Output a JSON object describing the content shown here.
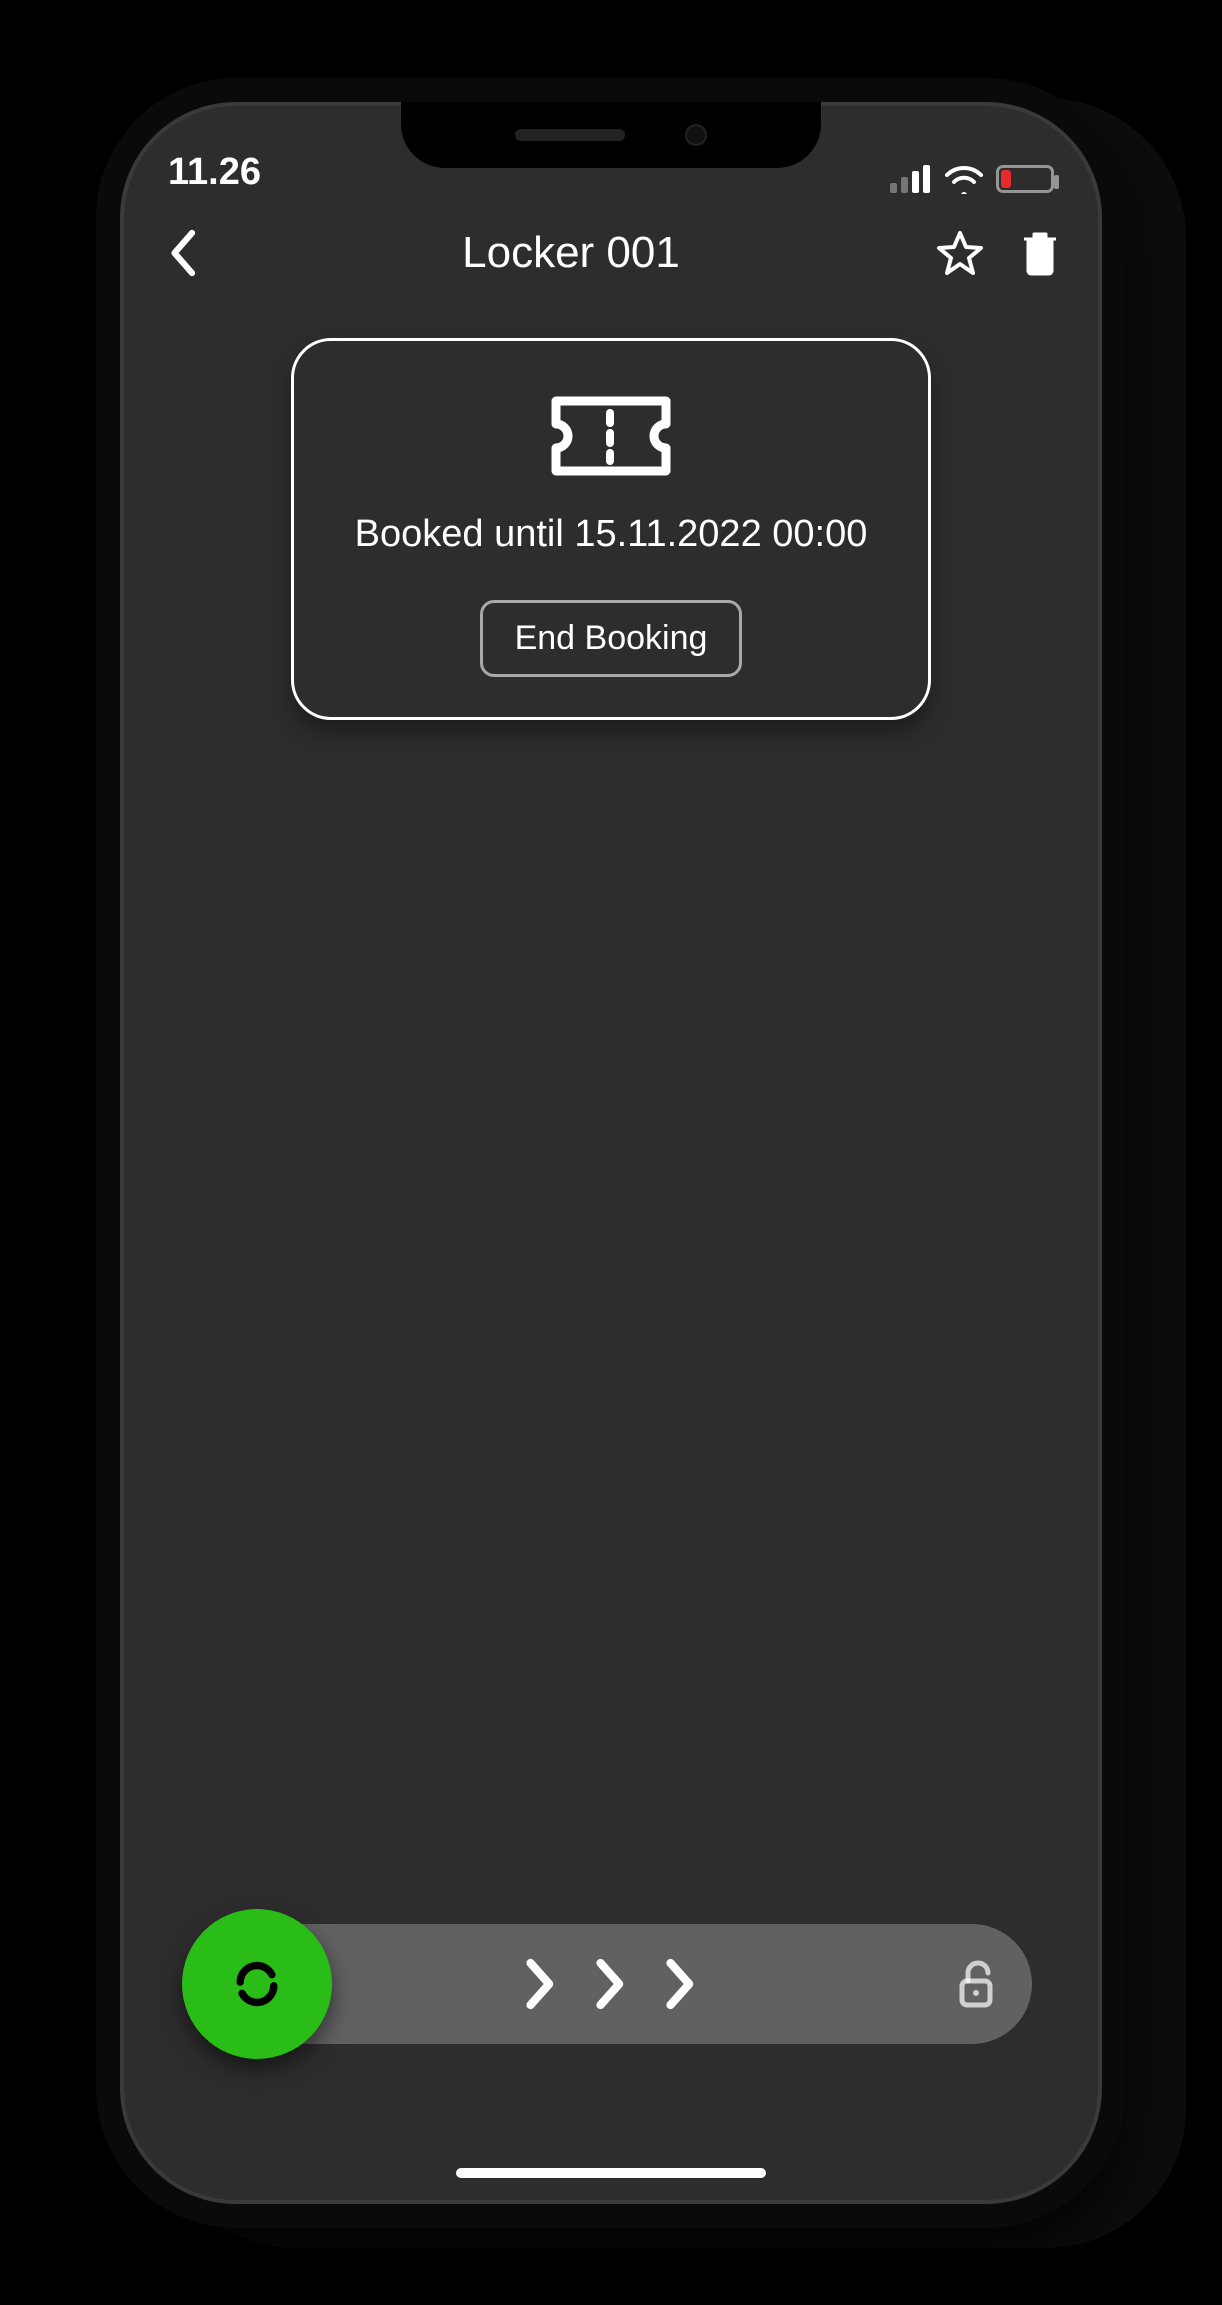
{
  "status": {
    "time": "11.26"
  },
  "nav": {
    "title": "Locker 001"
  },
  "card": {
    "booked_label": "Booked until 15.11.2022 00:00",
    "end_button": "End Booking"
  },
  "colors": {
    "accent": "#2bbd17",
    "battery_low": "#e52b2b"
  }
}
